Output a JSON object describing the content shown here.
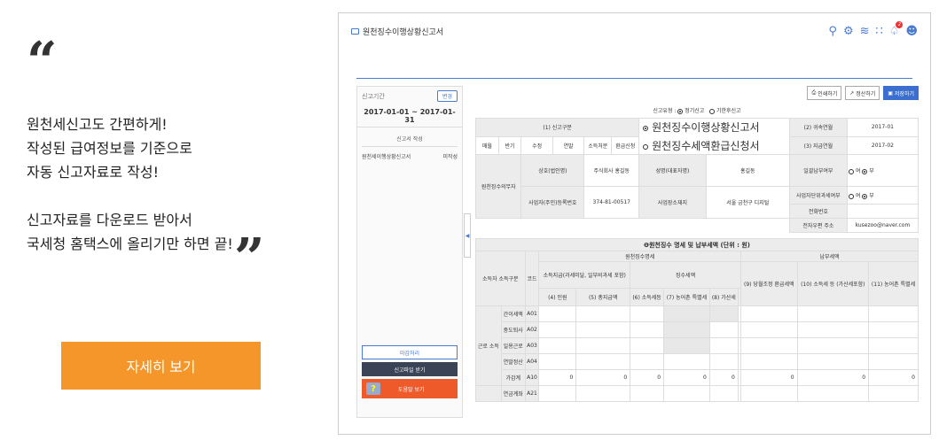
{
  "promo": {
    "quote_open": "“",
    "quote_close": "”",
    "line1": "원천세신고도 간편하게!",
    "line2": "작성된 급여정보를 기준으로",
    "line3": "자동 신고자료로 작성!",
    "line4": "신고자료를 다운로드 받아서",
    "line5": "국세청 홈택스에 올리기만 하면 끝!",
    "button": "자세히 보기",
    "button_color": "#f5962b"
  },
  "app": {
    "title": "원천징수이행상황신고서",
    "icons": [
      "search-icon",
      "gear-icon",
      "chart-icon",
      "grid-icon",
      "bell-icon",
      "user-icon"
    ],
    "notification_count": "2",
    "sidebar": {
      "period_label": "신고기간",
      "change_button": "변경",
      "period": "2017-01-01 ~ 2017-01-31",
      "section": "신고서 작성",
      "item_name": "원천세이행상황신고서",
      "item_status": "미작성",
      "close_button": "마감처리",
      "download_button": "신고파일 받기",
      "help_button": "도움말 보기"
    },
    "actions": {
      "print": "인쇄하기",
      "amend": "정산하기",
      "save": "저장하기"
    },
    "report_type": {
      "label": "신고유형 :",
      "regular": "정기신고",
      "late": "기한후신고"
    },
    "form": {
      "c1_label": "(1) 신고구분",
      "c1_items": [
        "매월",
        "반기",
        "수정",
        "연말",
        "소득처분",
        "환급신청"
      ],
      "title1": "원천징수이행상황신고서",
      "title2": "원천징수세액환급신청서",
      "belong_label": "(2) 귀속연월",
      "belong_value": "2017-01",
      "pay_label": "(3) 지급연월",
      "pay_value": "2017-02",
      "payer_label": "원천징수의무자",
      "company_label": "상호(법인명)",
      "company_value": "주식회사 홍길동",
      "name_label": "성명(대표자명)",
      "name_value": "홍길동",
      "batch_label": "일괄납부여부",
      "yes": "여",
      "no": "부",
      "unit_label": "사업자단위과세여부",
      "bizno_label": "사업자(주민)등록번호",
      "bizno_value": "374-81-00517",
      "addr_label": "사업장소재지",
      "addr_value": "서울 금천구 디지털",
      "tel_label": "전화번호",
      "email_label": "전자우편 주소",
      "email_value": "kusezoo@naver.com"
    },
    "summary": {
      "title": "❶원천징수 명세 및 납부세액 (단위 : 원)",
      "h_withheld": "원천징수명세",
      "h_payment": "납부세액",
      "h_kind": "소득자 소득구분",
      "h_code": "코드",
      "h_income": "소득지급(과세미달, 일부비과세 포함)",
      "h_tax": "징수세액",
      "h_c9": "(9) 당월조정 환급세액",
      "h_c10": "(10) 소득세 등 (가산세포함)",
      "h_c11": "(11) 농어촌 특별세",
      "h_c4": "(4) 인원",
      "h_c5": "(5) 총지급액",
      "h_c6": "(6) 소득세등",
      "h_c7": "(7) 농어촌 특별세",
      "h_c8": "(8) 가산세",
      "group_label": "근로 소득",
      "rows": [
        {
          "name": "간이세액",
          "code": "A01"
        },
        {
          "name": "중도퇴사",
          "code": "A02"
        },
        {
          "name": "일용근로",
          "code": "A03"
        },
        {
          "name": "연말정산",
          "code": "A04"
        },
        {
          "name": "가감계",
          "code": "A10",
          "values": [
            "0",
            "0",
            "0",
            "0",
            "0",
            "0",
            "0",
            "0"
          ]
        },
        {
          "name": "연금계좌",
          "code": "A21"
        }
      ]
    }
  }
}
